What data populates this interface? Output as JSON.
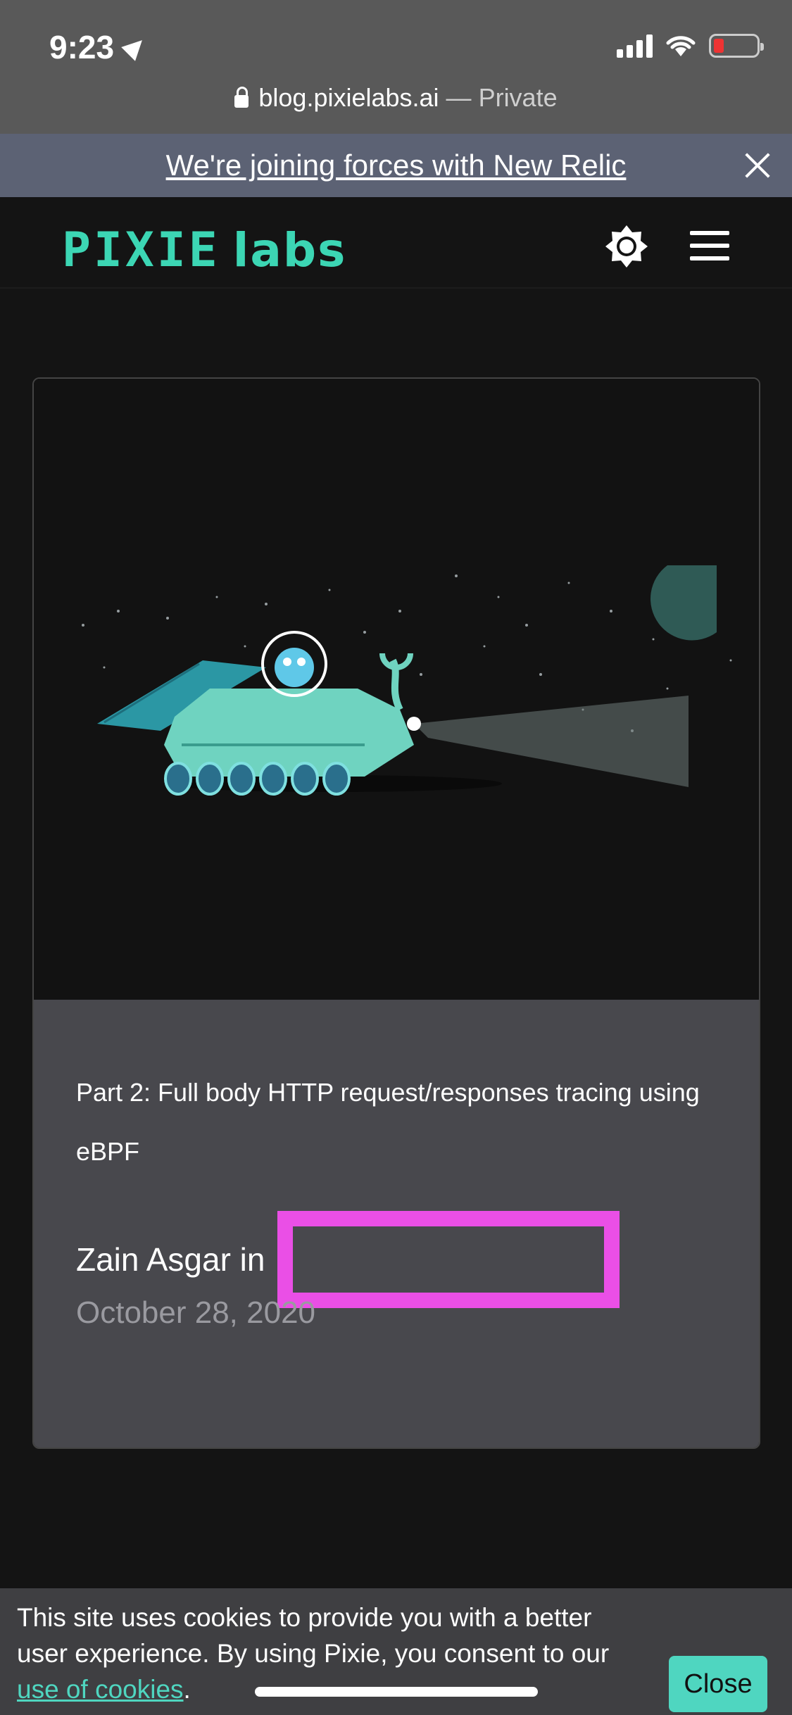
{
  "status_bar": {
    "time": "9:23"
  },
  "browser": {
    "domain": "blog.pixielabs.ai",
    "separator": " — ",
    "mode": "Private"
  },
  "announcement": {
    "text": "We're joining forces with New Relic"
  },
  "header": {
    "logo_main": "PIXIE",
    "logo_sub": "labs"
  },
  "post": {
    "title": "Part 2: Full body HTTP request/responses tracing using eBPF",
    "author_line": "Zain Asgar in",
    "date": "October 28, 2020"
  },
  "cookie_banner": {
    "text_before": "This site uses cookies to provide you with a better user experience. By using Pixie, you consent to our ",
    "link": "use of cookies",
    "text_after": ".",
    "button": "Close"
  },
  "colors": {
    "brand": "#3cd6b4",
    "accent": "#4fd6c0",
    "highlight": "#ea4fe6",
    "banner": "#5c6274"
  }
}
